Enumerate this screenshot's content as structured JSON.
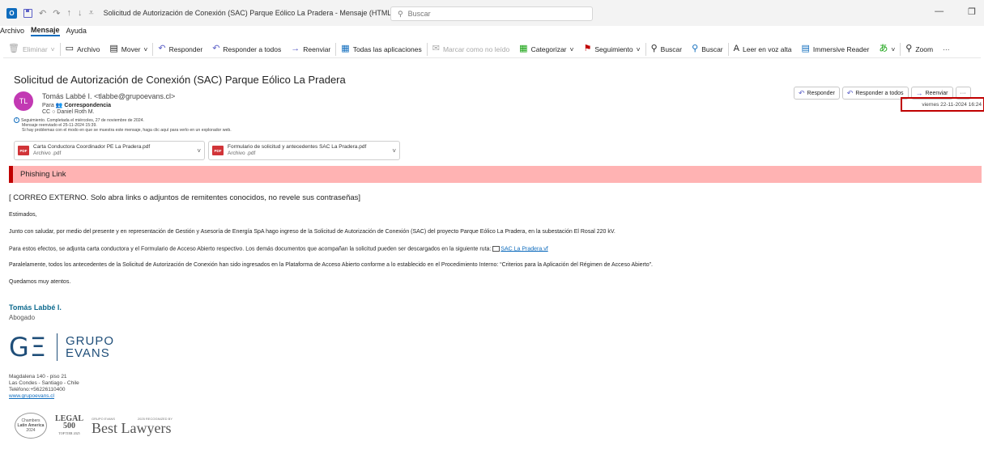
{
  "window": {
    "title": "Solicitud de Autorización de Conexión (SAC) Parque Eólico La Pradera - Mensaje (HTML)",
    "search_placeholder": "Buscar",
    "min_glyph": "—",
    "restore_glyph": "❐"
  },
  "menu": [
    "Archivo",
    "Mensaje",
    "Ayuda"
  ],
  "ribbon": {
    "eliminar": "Eliminar",
    "archivo": "Archivo",
    "mover": "Mover",
    "responder": "Responder",
    "responder_todos": "Responder a todos",
    "reenviar": "Reenviar",
    "todas_apps": "Todas las aplicaciones",
    "marcar_no_leido": "Marcar como no leído",
    "categorizar": "Categorizar",
    "seguimiento": "Seguimiento",
    "buscar1": "Buscar",
    "buscar2": "Buscar",
    "leer_voz": "Leer en voz alta",
    "immersive": "Immersive Reader",
    "zoom": "Zoom",
    "more": "···"
  },
  "message": {
    "subject": "Solicitud de Autorización de Conexión (SAC) Parque Eólico La Pradera",
    "avatar_initials": "TL",
    "sender": "Tomás Labbé I. <tlabbe@grupoevans.cl>",
    "to_label": "Para",
    "to_value": "Correspondencia",
    "cc_label": "CC",
    "cc_value": "Daniel Roth M.",
    "info_1": "Seguimiento.  Completada el miércoles, 27 de noviembre de 2024.",
    "info_2": "Mensaje reenviado el 25-11-2024 15:39.",
    "info_3": "Si hay problemas con el modo en que se muestra este mensaje, haga clic aquí para verlo en un explorador web.",
    "datetime": "viernes 22-11-2024 16:24",
    "actions": {
      "responder": "Responder",
      "responder_todos": "Responder a todos",
      "reenviar": "Reenviar",
      "more": "···"
    }
  },
  "attachments": [
    {
      "name": "Carta Conductora Coordinador PE La Pradera.pdf",
      "type": "Archivo .pdf",
      "icon": "PDF"
    },
    {
      "name": "Formulario de solicitud y antecedentes SAC La Pradera.pdf",
      "type": "Archivo .pdf",
      "icon": "PDF"
    }
  ],
  "banner": {
    "text": "Phishing Link"
  },
  "body": {
    "external_warning": "[ CORREO EXTERNO. Solo abra links o adjuntos de remitentes conocidos, no revele sus contraseñas]",
    "greeting": "Estimados,",
    "p1": "Junto con saludar, por medio del presente y en representación de Gestión y Asesoría de Energía SpA hago ingreso de la Solicitud de Autorización de Conexión (SAC) del proyecto Parque Eólico La Pradera, en la subestación El Rosal 220 kV.",
    "p2_before": "Para estos efectos, se adjunta carta conductora y el Formulario de Acceso Abierto respectivo. Los demás documentos que acompañan la solicitud pueden ser descargados en la siguiente ruta: ",
    "p2_link": "SAC La Pradera.vf",
    "p3": "Paralelamente, todos los antecedentes de la Solicitud de Autorización de Conexión han sido ingresados en la Plataforma de Acceso Abierto conforme a lo establecido en el Procedimiento Interno: “Criterios para la Aplicación del Régimen de Acceso Abierto”.",
    "closing": "Quedamos muy atentos."
  },
  "signature": {
    "name": "Tomás Labbé I.",
    "role": "Abogado",
    "logo_mark": "GΞ",
    "logo_line1": "GRUPO",
    "logo_line2": "EVANS",
    "address_1": "Magdalena 140 - piso 21",
    "address_2": "Las Condes - Santiago - Chile",
    "phone": "Teléfono:+56226110400",
    "website": "www.grupoevans.cl",
    "award_1_line1": "Chambers",
    "award_1_line2": "Latin America",
    "award_1_line3": "2024",
    "award_2_line1": "LEGAL",
    "award_2_line2": "500",
    "award_2_line3": "TOP TIER 2025",
    "award_3_top_left": "GRUPO EVANS",
    "award_3_top_right": "2025 RECOGNIZED BY",
    "award_3_main": "Best Lawyers"
  }
}
